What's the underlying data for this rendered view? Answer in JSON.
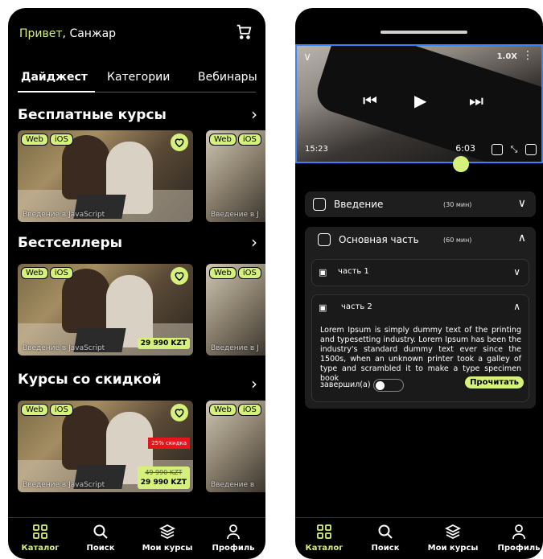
{
  "left": {
    "greeting_prefix": "Привет",
    "greeting_name": ", Санжар",
    "tabs": [
      "Дайджест",
      "Категории",
      "Вебинары"
    ],
    "sections": [
      {
        "title": "Бесплатные курсы"
      },
      {
        "title": "Бестселлеры"
      },
      {
        "title": "Курсы со скидкой"
      }
    ],
    "tags": [
      "Web",
      "iOS"
    ],
    "card_caption": "Введение в JavaScript",
    "peek_caption": "Введение в J",
    "peek_caption_short": "Введение в",
    "price": "29 990 KZT",
    "old_price": "49 990 KZT",
    "discount": "25% скидка",
    "nav": [
      "Каталог",
      "Поиск",
      "Мои курсы",
      "Профиль"
    ]
  },
  "right": {
    "video": {
      "speed": "1.0X",
      "time_left": "15:23",
      "time_right": "6:03"
    },
    "intro": {
      "title": "Введение",
      "duration": "(30 мин)"
    },
    "main": {
      "title": "Основная часть",
      "duration": "(60 мин)"
    },
    "part1": {
      "title": "часть 1"
    },
    "part2": {
      "title": "часть 2",
      "text": "Lorem Ipsum is simply dummy text of the printing and typesetting industry. Lorem Ipsum has been the industry's standard dummy text ever since the 1500s, when an unknown printer took a galley of type and scrambled it to make a type specimen book",
      "done_label": "завершил(а)",
      "read_button": "Прочитать"
    },
    "nav": [
      "Каталог",
      "Поиск",
      "Мои курсы",
      "Профиль"
    ]
  },
  "colors": {
    "accent": "#d6f07c",
    "background": "#000000",
    "panel": "#1e1e1e",
    "discount": "#e8141c"
  },
  "icons": [
    "cart-icon",
    "heart-icon",
    "chevron-right-icon",
    "catalog-icon",
    "search-icon",
    "layers-icon",
    "profile-icon",
    "play-icon",
    "skip-back-icon",
    "skip-forward-icon",
    "chevron-down-icon",
    "doc-icon"
  ]
}
